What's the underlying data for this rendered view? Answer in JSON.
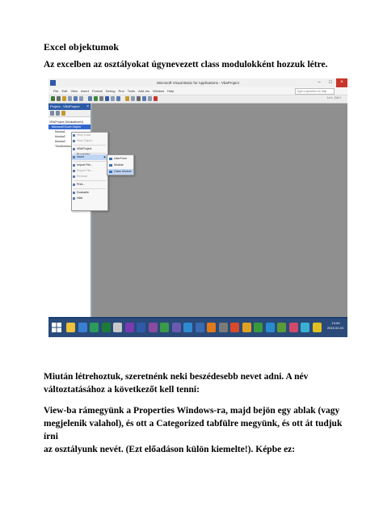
{
  "doc": {
    "title": "Excel objektumok",
    "intro": "Az excelben az osztályokat úgynevezett class modulokként hozzuk létre.",
    "para1": [
      "Miután létrehoztuk, szeretnénk neki beszédesebb nevet adni. A név",
      "változtatásához a következőt kell tenni:"
    ],
    "para2": [
      "View-ba rámegyünk a Properties Windows-ra, majd bejön egy ablak (vagy",
      "megjelenik valahol), és ott a Categorized tabfülre megyünk, és ott át tudjuk írni",
      "az osztályunk nevét. (Ezt előadáson külön kiemelte!). Képbe ez:"
    ]
  },
  "screenshot": {
    "window_title": "Microsoft Visual Basic for Applications - VbaProject",
    "menu": [
      "File",
      "Edit",
      "View",
      "Insert",
      "Format",
      "Debug",
      "Run",
      "Tools",
      "Add-Ins",
      "Window",
      "Help"
    ],
    "help_placeholder": "Type a question for help",
    "toolbar_position": "Ln 1, Col 1",
    "project_pane_title": "Project - VBAProject",
    "tree": [
      "VBAProject (Munkafüzet1)",
      "Microsoft Excel Objekt",
      "Munka1",
      "Munka2",
      "Munka3",
      "ThisWorkbook"
    ],
    "context_menu": [
      {
        "label": "View Code",
        "disabled": true
      },
      {
        "label": "View Object",
        "disabled": true
      },
      {
        "sep": true
      },
      {
        "label": "VBAProject Properties...",
        "disabled": false
      },
      {
        "sep": true
      },
      {
        "label": "Insert",
        "disabled": false,
        "submenu": true,
        "highlight": true
      },
      {
        "sep": true
      },
      {
        "label": "Import File...",
        "disabled": false
      },
      {
        "label": "Export File...",
        "disabled": true
      },
      {
        "label": "Remove",
        "disabled": true
      },
      {
        "sep": true
      },
      {
        "label": "Print...",
        "disabled": false
      },
      {
        "sep": true
      },
      {
        "label": "Dockable",
        "disabled": false
      },
      {
        "label": "Hide",
        "disabled": false
      }
    ],
    "submenu": [
      {
        "label": "UserForm"
      },
      {
        "label": "Module"
      },
      {
        "label": "Class Module",
        "highlight": true
      }
    ],
    "clock_time": "13:09",
    "clock_date": "2015.02.20."
  },
  "colors": {
    "taskbar": "#2a4a7a",
    "code_area": "#8f8f8f",
    "highlight": "#bfd6f5",
    "close": "#c8352b"
  }
}
